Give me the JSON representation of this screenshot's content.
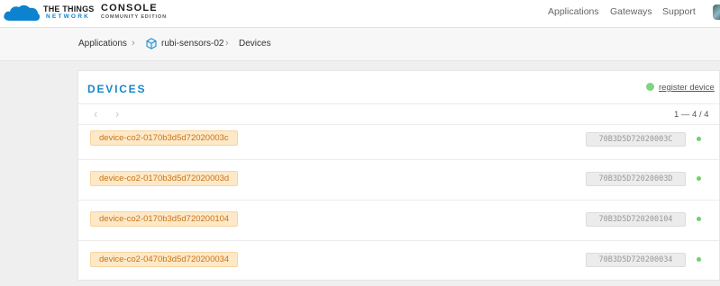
{
  "header": {
    "logo": {
      "line1": "THE THINGS",
      "line2": "NETWORK"
    },
    "console": {
      "title": "CONSOLE",
      "subtitle": "COMMUNITY EDITION"
    },
    "nav": {
      "applications": "Applications",
      "gateways": "Gateways",
      "support": "Support"
    }
  },
  "breadcrumb": {
    "applications": "Applications",
    "app": "rubi-sensors-02",
    "devices": "Devices"
  },
  "devices_panel": {
    "title": "DEVICES",
    "register_label": "register device",
    "pager": {
      "range": "1 — 4 / 4"
    },
    "devices": [
      {
        "id": "device-co2-0170b3d5d72020003c",
        "eui": "70B3D5D72020003C",
        "status": "online"
      },
      {
        "id": "device-co2-0170b3d5d72020003d",
        "eui": "70B3D5D72020003D",
        "status": "online"
      },
      {
        "id": "device-co2-0170b3d5d720200104",
        "eui": "70B3D5D720200104",
        "status": "online"
      },
      {
        "id": "device-co2-0470b3d5d720200034",
        "eui": "70B3D5D720200034",
        "status": "online"
      }
    ]
  },
  "colors": {
    "accent": "#1986c7",
    "tag_bg": "#fde9c7",
    "tag_text": "#c9741b",
    "status_online": "#6cd36c"
  }
}
